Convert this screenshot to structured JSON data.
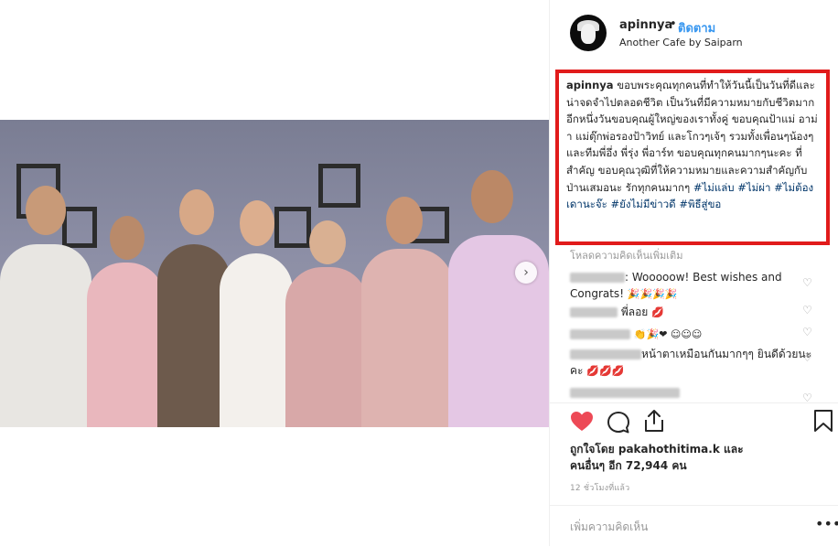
{
  "post": {
    "username": "apinnya",
    "dot": "•",
    "follow_label": "ติดตาม",
    "location": "Another Cafe by Saiparn"
  },
  "caption": {
    "user": "apinnya",
    "text": " ขอบพระคุณทุกคนที่ทำให้วันนี้เป็นวันที่ดีและน่าจดจำไปตลอดชีวิต เป็นวันที่มีความหมายกับชีวิตมากอีกหนึ่งวันขอบคุณผู้ใหญ่ของเราทั้งคู่ ขอบคุณป้าแม่ อาม่า แม่ตุ๊กพ่อรองป้าวิทย์ และโกวๆเจ้ๆ รวมทั้งเพื่อนๆน้องๆและทีมพี่อึ่ง พี่รุ่ง พี่อาร์ท ขอบคุณทุกคนมากๆนะคะ ที่สำคัญ ขอบคุณวุฒิที่ให้ความหมายและความสำคัญกับป่านเสมอนะ รักทุกคนมากๆ ",
    "hashtags": [
      "#ไม่แล่บ",
      "#ไม่ผ่า",
      "#ไม่ต้องเดานะจ๊ะ",
      "#ยังไม่มีข่าวดี",
      "#พิธีสู่ขอ"
    ]
  },
  "comments": {
    "more_label": "โหลดความคิดเห็นเพิ่มเติม",
    "items": [
      {
        "text": ": Wooooow! Best wishes and Congrats!",
        "emoji": "🎉🎉🎉🎉"
      },
      {
        "text": "พี่ลอย",
        "emoji": "💋"
      },
      {
        "text": "",
        "emoji": "👏🎉❤ ☺☺☺"
      },
      {
        "text": "หน้าตาเหมือนกันมากๆๆ ยินดีด้วยนะคะ",
        "emoji": "💋💋💋"
      }
    ]
  },
  "likes": {
    "line1": "ถูกใจโดย pakahothitima.k และ",
    "line2": "คนอื่นๆ อีก 72,944 คน"
  },
  "time": "12 ชั่วโมงที่แล้ว",
  "add_comment": {
    "placeholder": "เพิ่มความคิดเห็น",
    "more": "•••"
  },
  "colors": {
    "accent": "#3897f0",
    "like_red": "#ed4956",
    "highlight_border": "#e11b1b"
  }
}
